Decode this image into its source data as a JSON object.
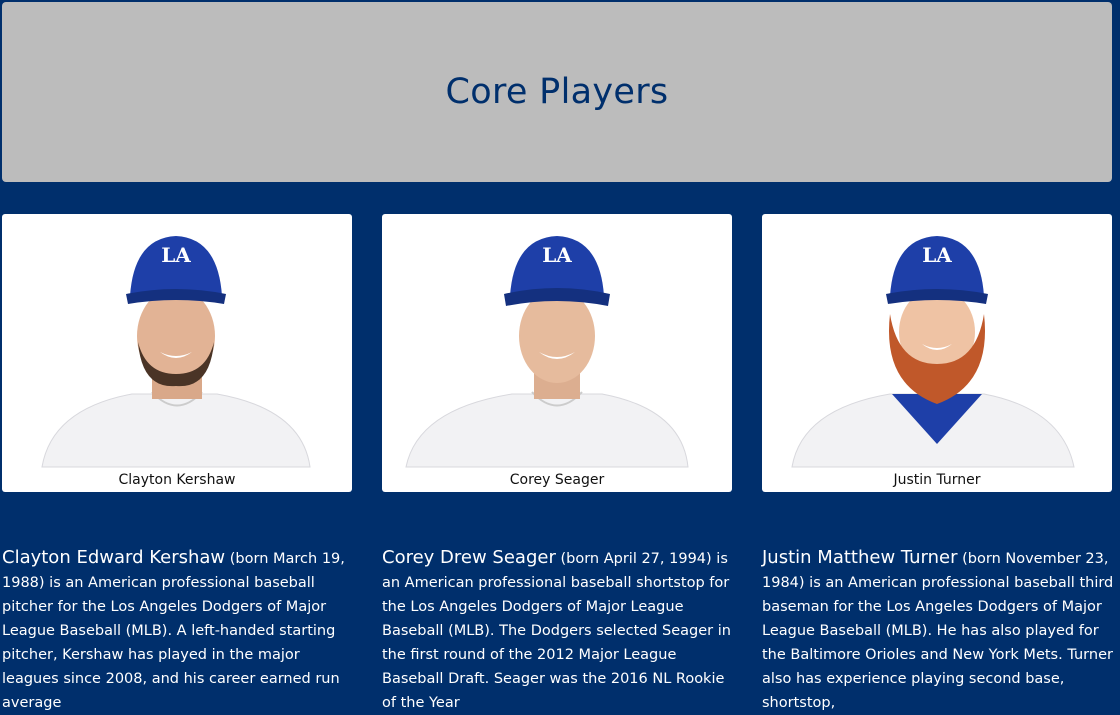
{
  "header": {
    "title": "Core Players"
  },
  "players": [
    {
      "caption": "Clayton Kershaw",
      "full_name": "Clayton Edward Kershaw",
      "bio": "(born March 19, 1988) is an American professional baseball pitcher for the Los Angeles Dodgers of Major League Baseball (MLB). A left-handed starting pitcher, Kershaw has played in the major leagues since 2008, and his career earned run average"
    },
    {
      "caption": "Corey Seager",
      "full_name": "Corey Drew Seager",
      "bio": "(born April 27, 1994) is an American professional baseball shortstop for the Los Angeles Dodgers of Major League Baseball (MLB). The Dodgers selected Seager in the first round of the 2012 Major League Baseball Draft. Seager was the 2016 NL Rookie of the Year"
    },
    {
      "caption": "Justin Turner",
      "full_name": "Justin Matthew Turner",
      "bio": "(born November 23, 1984) is an American professional baseball third baseman for the Los Angeles Dodgers of Major League Baseball (MLB). He has also played for the Baltimore Orioles and New York Mets. Turner also has experience playing second base, shortstop,"
    }
  ],
  "colors": {
    "background": "#002f6c",
    "header_bg": "#bcbcbc",
    "cap_blue": "#1e3fa8"
  }
}
